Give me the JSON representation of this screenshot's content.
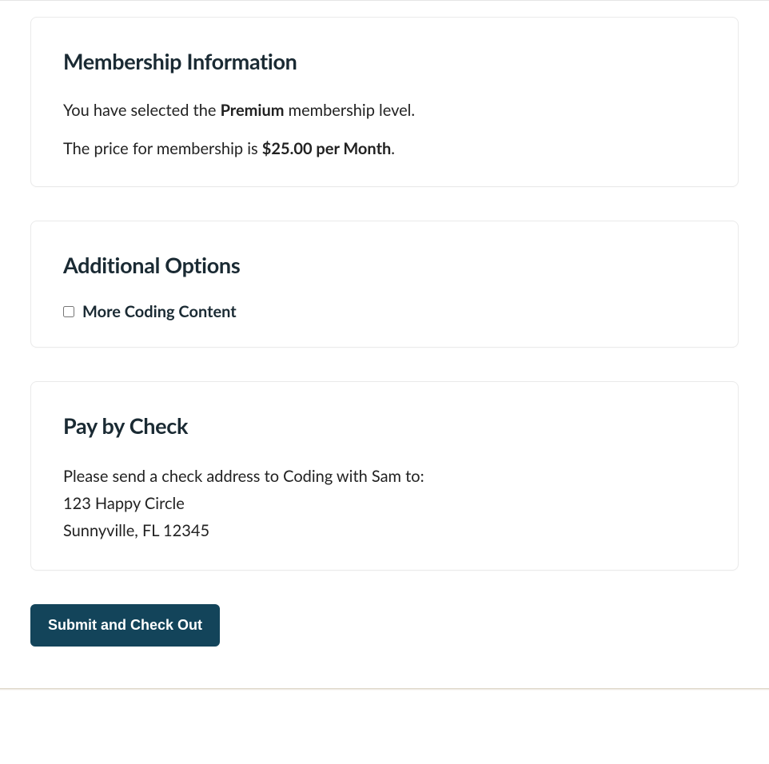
{
  "membership": {
    "heading": "Membership Information",
    "line1_pre": "You have selected the ",
    "line1_strong": "Premium",
    "line1_post": " membership level.",
    "line2_pre": "The price for membership is ",
    "line2_strong": "$25.00 per Month",
    "line2_post": "."
  },
  "options": {
    "heading": "Additional Options",
    "item1_label": "More Coding Content"
  },
  "payment": {
    "heading": "Pay by Check",
    "intro": "Please send a check address to Coding with Sam to:",
    "address_line1": "123 Happy Circle",
    "address_line2": "Sunnyville, FL 12345"
  },
  "submit_label": "Submit and Check Out"
}
